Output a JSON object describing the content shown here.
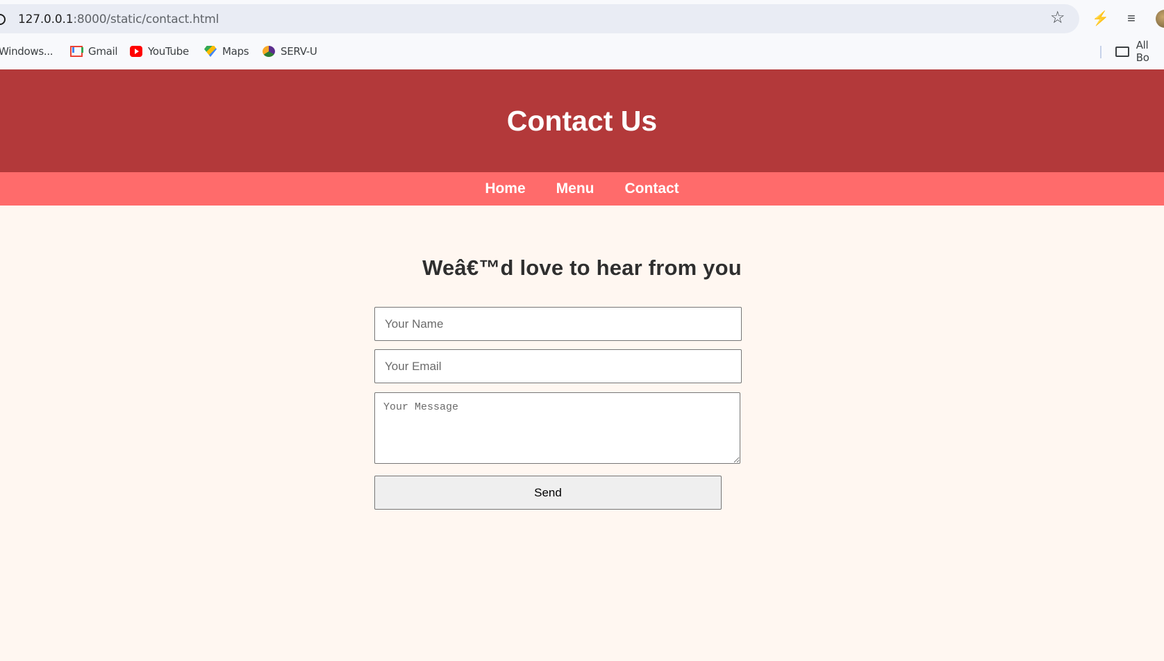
{
  "browser": {
    "url_host": "127.0.0.1",
    "url_rest": ":8000/static/contact.html",
    "bookmarks": [
      {
        "label": "Windows...",
        "icon": "windows-icon"
      },
      {
        "label": "Gmail",
        "icon": "gmail-icon"
      },
      {
        "label": "YouTube",
        "icon": "youtube-icon"
      },
      {
        "label": "Maps",
        "icon": "maps-icon"
      },
      {
        "label": "SERV-U",
        "icon": "serv-u-icon"
      }
    ],
    "all_bookmarks_label": "All Bo"
  },
  "header": {
    "title": "Contact Us",
    "bg_color": "#b3393a"
  },
  "nav": {
    "items": [
      "Home",
      "Menu",
      "Contact"
    ],
    "bg_color": "#ff6b6b"
  },
  "main": {
    "heading": "Weâ€™d love to hear from you",
    "form": {
      "name_placeholder": "Your Name",
      "email_placeholder": "Your Email",
      "message_placeholder": "Your Message",
      "send_label": "Send"
    }
  }
}
